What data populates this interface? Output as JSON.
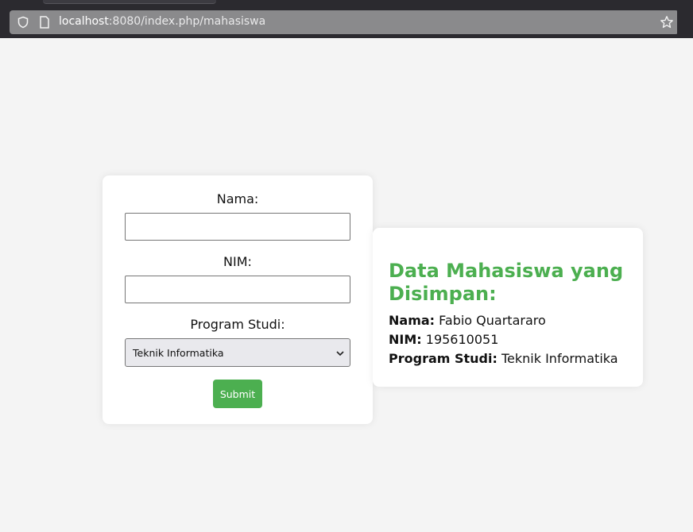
{
  "browser": {
    "url_host": "localhost",
    "url_rest": ":8080/index.php/mahasiswa"
  },
  "form": {
    "nama_label": "Nama:",
    "nama_value": "",
    "nim_label": "NIM:",
    "nim_value": "",
    "prodi_label": "Program Studi:",
    "prodi_selected": "Teknik Informatika",
    "submit_label": "Submit"
  },
  "result": {
    "heading": "Data Mahasiswa yang Disimpan:",
    "nama_key": "Nama:",
    "nama_value": "Fabio Quartararo",
    "nim_key": "NIM:",
    "nim_value": "195610051",
    "prodi_key": "Program Studi:",
    "prodi_value": "Teknik Informatika"
  },
  "colors": {
    "accent": "#4caf50",
    "background": "#f4f4f4"
  }
}
